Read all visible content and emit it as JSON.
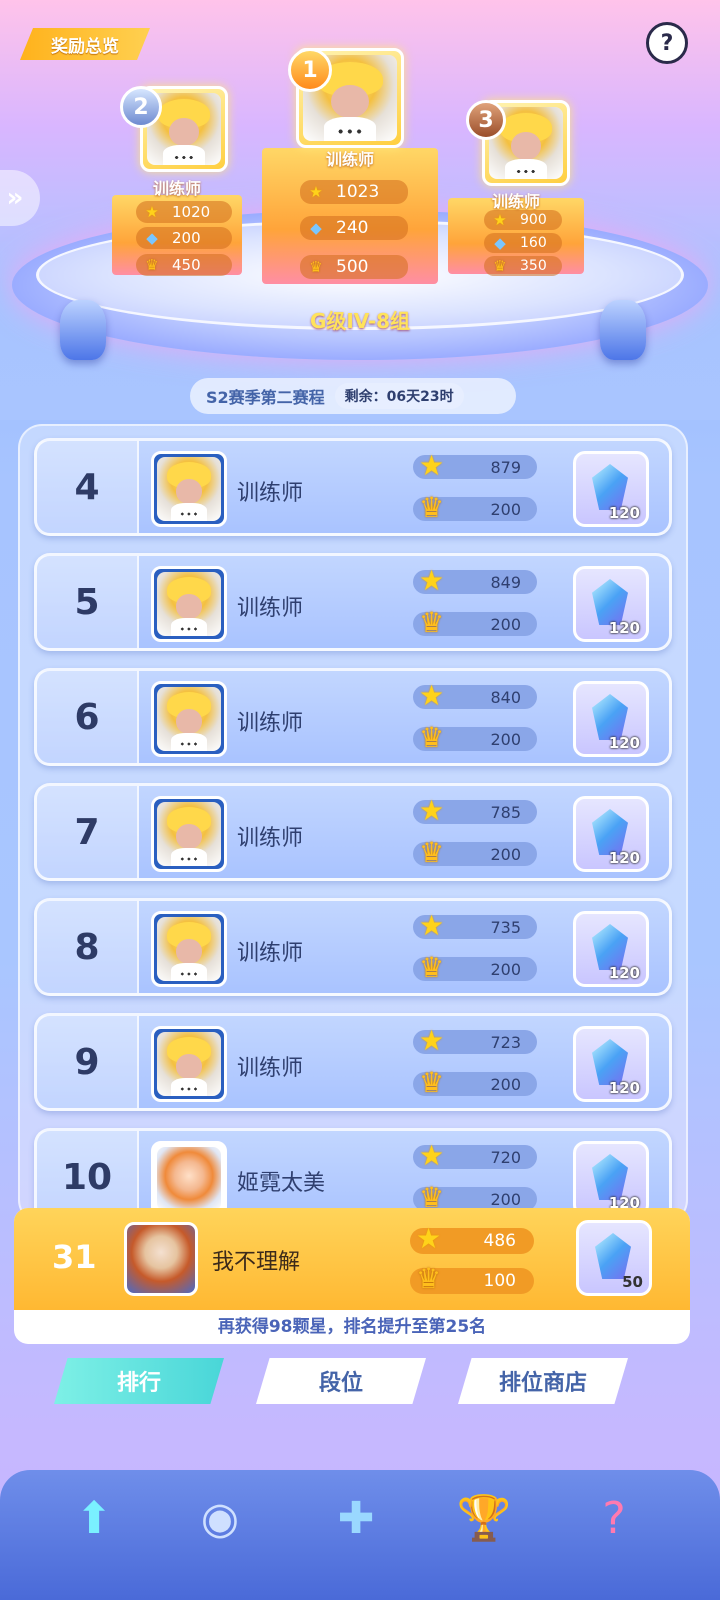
{
  "header": {
    "reward_overview": "奖励总览",
    "help": "?"
  },
  "podium": {
    "group": "G级IV-8组",
    "first": {
      "rank": "1",
      "name": "训练师",
      "stars": "1023",
      "gems": "240",
      "crowns": "500"
    },
    "second": {
      "rank": "2",
      "name": "训练师",
      "stars": "1020",
      "gems": "200",
      "crowns": "450"
    },
    "third": {
      "rank": "3",
      "name": "训练师",
      "stars": "900",
      "gems": "160",
      "crowns": "350"
    }
  },
  "season": {
    "title": "S2赛季第二赛程",
    "remaining": "剩余：06天23时"
  },
  "rows": [
    {
      "rank": "4",
      "name": "训练师",
      "stars": "879",
      "crowns": "200",
      "reward": "120"
    },
    {
      "rank": "5",
      "name": "训练师",
      "stars": "849",
      "crowns": "200",
      "reward": "120"
    },
    {
      "rank": "6",
      "name": "训练师",
      "stars": "840",
      "crowns": "200",
      "reward": "120"
    },
    {
      "rank": "7",
      "name": "训练师",
      "stars": "785",
      "crowns": "200",
      "reward": "120"
    },
    {
      "rank": "8",
      "name": "训练师",
      "stars": "735",
      "crowns": "200",
      "reward": "120"
    },
    {
      "rank": "9",
      "name": "训练师",
      "stars": "723",
      "crowns": "200",
      "reward": "120"
    },
    {
      "rank": "10",
      "name": "姬霓太美",
      "stars": "720",
      "crowns": "200",
      "reward": "120"
    }
  ],
  "me": {
    "rank": "31",
    "name": "我不理解",
    "stars": "486",
    "crowns": "100",
    "reward": "50",
    "hint": "再获得98颗星，排名提升至第25名"
  },
  "tabs": [
    "排行",
    "段位",
    "排位商店"
  ],
  "icons": {
    "star": "star-icon",
    "crown": "crown-icon",
    "gem": "gem-icon"
  },
  "colors": {
    "accent_gold": "#ffb832",
    "tab_active": "#49d6d8",
    "text_blue": "#4464a8"
  }
}
